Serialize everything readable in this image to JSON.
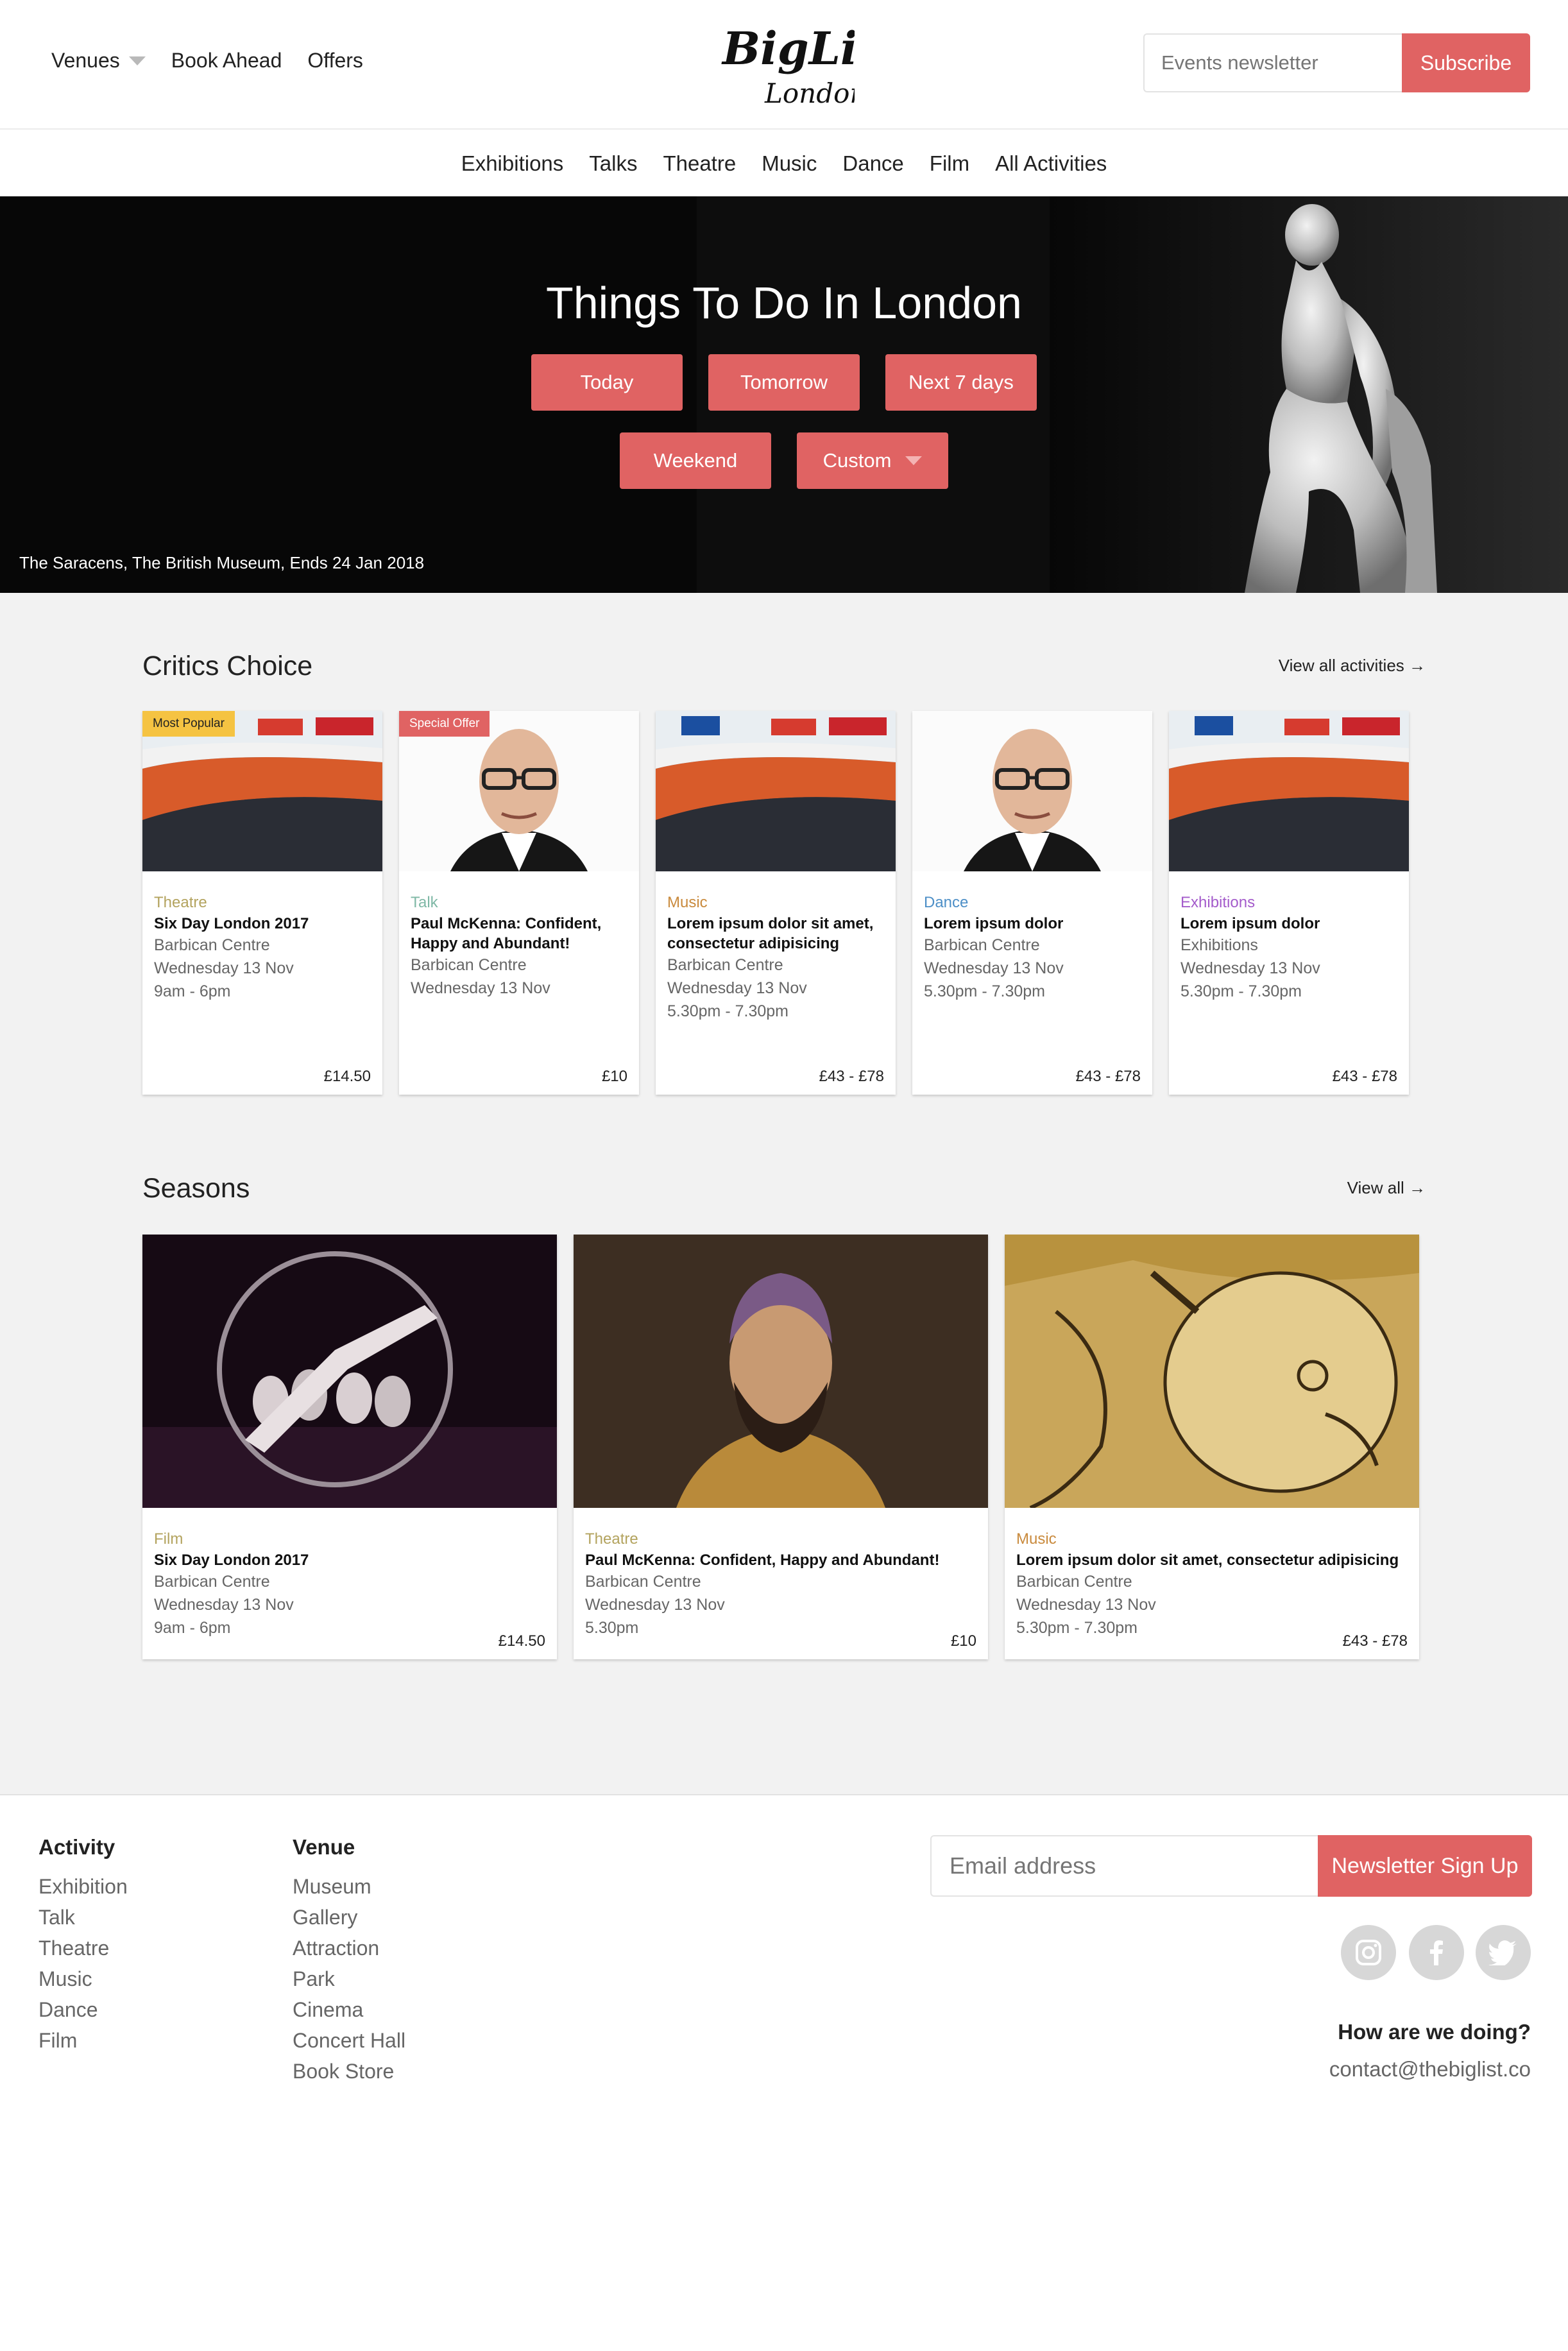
{
  "header": {
    "nav": [
      {
        "label": "Venues",
        "has_caret": true
      },
      {
        "label": "Book Ahead"
      },
      {
        "label": "Offers"
      }
    ],
    "logo_text_1": "BigList",
    "logo_text_2": "London",
    "newsletter_placeholder": "Events newsletter",
    "subscribe_label": "Subscribe"
  },
  "categories": [
    "Exhibitions",
    "Talks",
    "Theatre",
    "Music",
    "Dance",
    "Film",
    "All Activities"
  ],
  "hero": {
    "title": "Things To Do In London",
    "buttons_row1": [
      "Today",
      "Tomorrow",
      "Next 7 days"
    ],
    "buttons_row2": [
      "Weekend",
      "Custom"
    ],
    "caption": "The Saracens, The British Museum, Ends 24 Jan 2018"
  },
  "critics_choice": {
    "title": "Critics Choice",
    "link": "View all activities →",
    "cards": [
      {
        "badge": "Most Popular",
        "badge_type": "popular",
        "image": "cycling-track",
        "category": "Theatre",
        "category_color": "#b3a35e",
        "title": "Six Day London 2017",
        "venue": "Barbican Centre",
        "date": "Wednesday 13 Nov",
        "time": "9am - 6pm",
        "price": "£14.50"
      },
      {
        "badge": "Special Offer",
        "badge_type": "offer",
        "image": "portrait-man-glasses",
        "category": "Talk",
        "category_color": "#7fb8a6",
        "title": "Paul McKenna: Confident, Happy and Abundant!",
        "venue": "Barbican Centre",
        "date": "Wednesday 13 Nov",
        "time": "",
        "price": "£10"
      },
      {
        "badge": "",
        "badge_type": "",
        "image": "cycling-track",
        "category": "Music",
        "category_color": "#c98a3d",
        "title": "Lorem ipsum dolor sit amet, consectetur adipisicing",
        "venue": "Barbican Centre",
        "date": "Wednesday 13 Nov",
        "time": "5.30pm - 7.30pm",
        "price": "£43 - £78"
      },
      {
        "badge": "",
        "badge_type": "",
        "image": "portrait-man-glasses",
        "category": "Dance",
        "category_color": "#4d8fc7",
        "title": "Lorem ipsum dolor",
        "venue": "Barbican Centre",
        "date": "Wednesday 13 Nov",
        "time": "5.30pm - 7.30pm",
        "price": "£43 - £78"
      },
      {
        "badge": "",
        "badge_type": "",
        "image": "cycling-track",
        "category": "Exhibitions",
        "category_color": "#a45ccb",
        "title": "Lorem ipsum dolor",
        "venue": "Exhibitions",
        "date": "Wednesday 13 Nov",
        "time": "5.30pm - 7.30pm",
        "price": "£43 - £78"
      }
    ]
  },
  "seasons": {
    "title": "Seasons",
    "link": "View all →",
    "cards": [
      {
        "image": "circus-hoop",
        "category": "Film",
        "category_color": "#b3a35e",
        "title": "Six Day London 2017",
        "venue": "Barbican Centre",
        "date": "Wednesday 13 Nov",
        "time": "9am - 6pm",
        "price": "£14.50"
      },
      {
        "image": "turban-portrait",
        "category": "Theatre",
        "category_color": "#b3a35e",
        "title": "Paul McKenna: Confident, Happy and Abundant!",
        "venue": "Barbican Centre",
        "date": "Wednesday 13 Nov",
        "time": "5.30pm",
        "price": "£10"
      },
      {
        "image": "engraving-grotesque-head",
        "category": "Music",
        "category_color": "#c98a3d",
        "title": "Lorem ipsum dolor sit amet, consectetur adipisicing",
        "venue": "Barbican Centre",
        "date": "Wednesday 13 Nov",
        "time": "5.30pm - 7.30pm",
        "price": "£43 - £78"
      }
    ]
  },
  "footer": {
    "activity_heading": "Activity",
    "activity_links": [
      "Exhibition",
      "Talk",
      "Theatre",
      "Music",
      "Dance",
      "Film"
    ],
    "venue_heading": "Venue",
    "venue_links": [
      "Museum",
      "Gallery",
      "Attraction",
      "Park",
      "Cinema",
      "Concert Hall",
      "Book Store"
    ],
    "email_placeholder": "Email address",
    "signup_label": "Newsletter Sign Up",
    "social": [
      "instagram-icon",
      "facebook-icon",
      "twitter-icon"
    ],
    "feedback": "How are we doing?",
    "contact": "contact@thebiglist.co"
  },
  "colors": {
    "accent": "#e06363",
    "badge_popular": "#f5c342"
  }
}
